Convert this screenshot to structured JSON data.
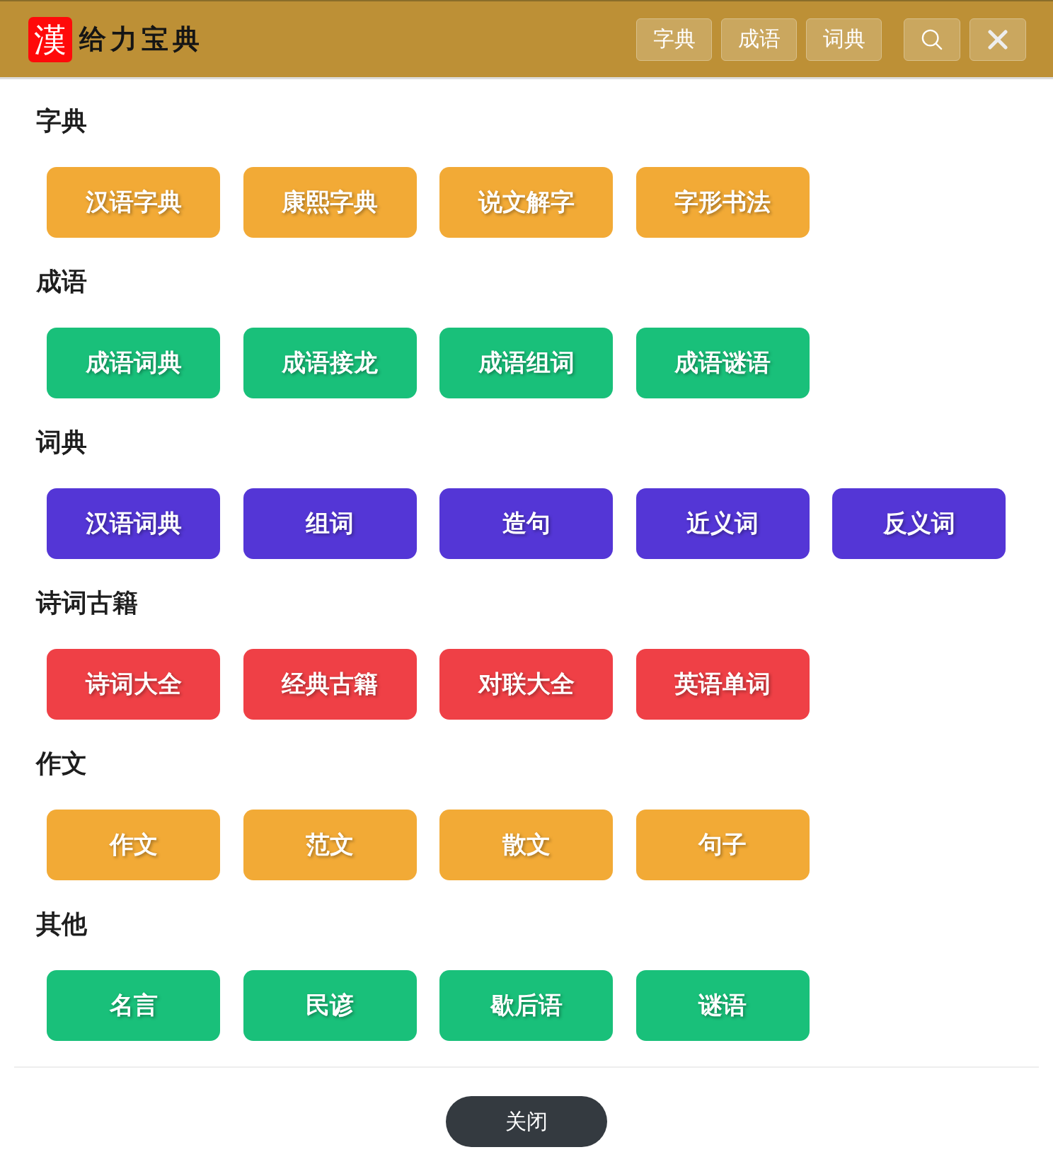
{
  "header": {
    "logo": {
      "mark": "漢",
      "title": "给力宝典"
    },
    "nav": [
      "字典",
      "成语",
      "词典"
    ]
  },
  "sections": [
    {
      "title": "字典",
      "color": "#f2aa36",
      "links": [
        "汉语字典",
        "康熙字典",
        "说文解字",
        "字形书法"
      ]
    },
    {
      "title": "成语",
      "color": "#19c07a",
      "links": [
        "成语词典",
        "成语接龙",
        "成语组词",
        "成语谜语"
      ]
    },
    {
      "title": "词典",
      "color": "#5436d6",
      "links": [
        "汉语词典",
        "组词",
        "造句",
        "近义词",
        "反义词"
      ]
    },
    {
      "title": "诗词古籍",
      "color": "#ef4046",
      "links": [
        "诗词大全",
        "经典古籍",
        "对联大全",
        "英语单词"
      ]
    },
    {
      "title": "作文",
      "color": "#f2aa36",
      "links": [
        "作文",
        "范文",
        "散文",
        "句子"
      ]
    },
    {
      "title": "其他",
      "color": "#19c07a",
      "links": [
        "名言",
        "民谚",
        "歇后语",
        "谜语"
      ]
    }
  ],
  "footer": {
    "button": "关闭"
  }
}
